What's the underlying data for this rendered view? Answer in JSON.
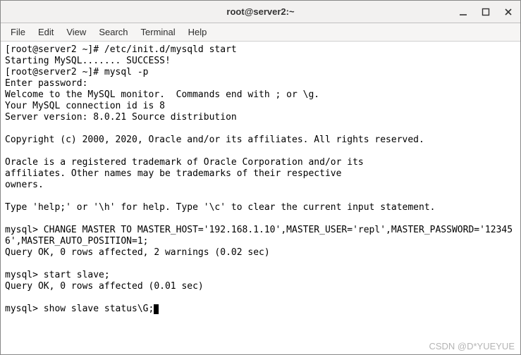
{
  "window": {
    "title": "root@server2:~"
  },
  "menu": {
    "file": "File",
    "edit": "Edit",
    "view": "View",
    "search": "Search",
    "terminal": "Terminal",
    "help": "Help"
  },
  "terminal": {
    "lines": "[root@server2 ~]# /etc/init.d/mysqld start\nStarting MySQL....... SUCCESS!\n[root@server2 ~]# mysql -p\nEnter password:\nWelcome to the MySQL monitor.  Commands end with ; or \\g.\nYour MySQL connection id is 8\nServer version: 8.0.21 Source distribution\n\nCopyright (c) 2000, 2020, Oracle and/or its affiliates. All rights reserved.\n\nOracle is a registered trademark of Oracle Corporation and/or its\naffiliates. Other names may be trademarks of their respective\nowners.\n\nType 'help;' or '\\h' for help. Type '\\c' to clear the current input statement.\n\nmysql> CHANGE MASTER TO MASTER_HOST='192.168.1.10',MASTER_USER='repl',MASTER_PASSWORD='123456',MASTER_AUTO_POSITION=1;\nQuery OK, 0 rows affected, 2 warnings (0.02 sec)\n\nmysql> start slave;\nQuery OK, 0 rows affected (0.01 sec)\n\nmysql> show slave status\\G;"
  },
  "watermark": "CSDN @D*YUEYUE"
}
